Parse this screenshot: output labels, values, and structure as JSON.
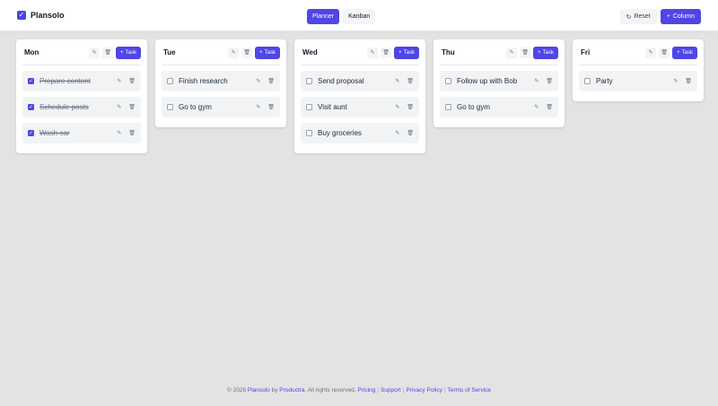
{
  "app": {
    "name": "Plansolo",
    "brand_icon": "check-square-icon",
    "accent": "#4f46e5"
  },
  "header": {
    "tabs": [
      {
        "label": "Planner",
        "active": true
      },
      {
        "label": "Kanban",
        "active": false
      }
    ],
    "reset_label": "Reset",
    "reset_icon": "refresh-icon",
    "add_column_label": "Column"
  },
  "columns": [
    {
      "title": "Mon",
      "add_label": "Task",
      "tasks": [
        {
          "label": "Prepare content",
          "done": true
        },
        {
          "label": "Schedule posts",
          "done": true
        },
        {
          "label": "Wash car",
          "done": true
        }
      ]
    },
    {
      "title": "Tue",
      "add_label": "Task",
      "tasks": [
        {
          "label": "Finish research",
          "done": false
        },
        {
          "label": "Go to gym",
          "done": false
        }
      ]
    },
    {
      "title": "Wed",
      "add_label": "Task",
      "tasks": [
        {
          "label": "Send proposal",
          "done": false
        },
        {
          "label": "Visit aunt",
          "done": false
        },
        {
          "label": "Buy groceries",
          "done": false
        }
      ]
    },
    {
      "title": "Thu",
      "add_label": "Task",
      "tasks": [
        {
          "label": "Follow up with Bob",
          "done": false
        },
        {
          "label": "Go to gym",
          "done": false
        }
      ]
    },
    {
      "title": "Fri",
      "add_label": "Task",
      "tasks": [
        {
          "label": "Party",
          "done": false
        }
      ]
    }
  ],
  "footer": {
    "copyright": "© 2026",
    "product": "Plansolo",
    "by": "by",
    "company": "Productra",
    "rights": ". All rights reserved.",
    "links": [
      "Pricing",
      "Support",
      "Privacy Policy",
      "Terms of Service"
    ],
    "separator": "|"
  }
}
